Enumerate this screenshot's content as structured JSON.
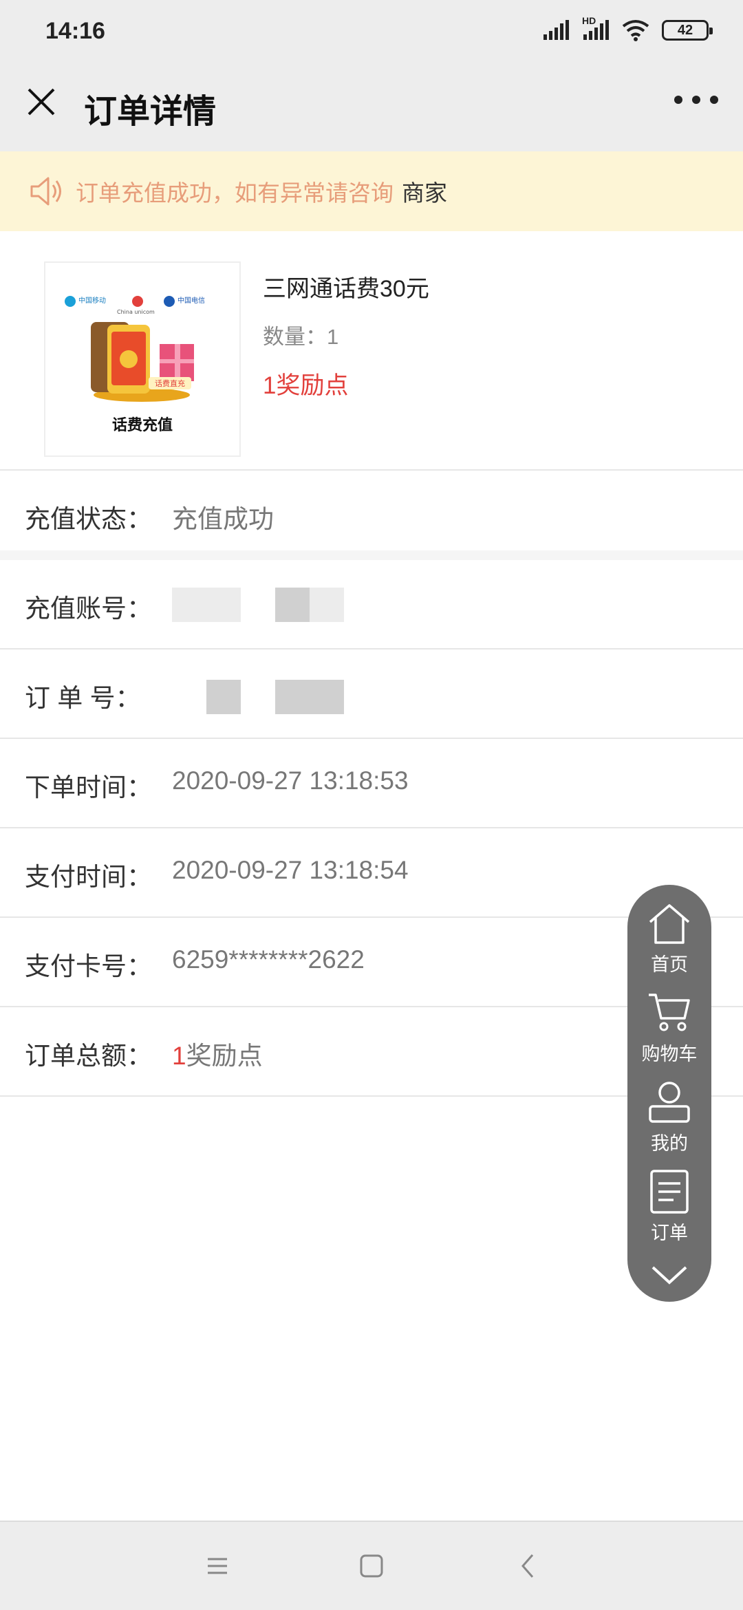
{
  "status": {
    "time": "14:16",
    "battery": "42",
    "signal_hd": "HD"
  },
  "header": {
    "title": "订单详情"
  },
  "notice": {
    "text": "订单充值成功，如有异常请咨询",
    "link": "商家"
  },
  "product": {
    "name": "三网通话费30元",
    "qty_label": "数量：",
    "qty": "1",
    "price": "1奖励点",
    "thumb_caption": "话费充值",
    "thumb_badge": "话费直充",
    "thumb_brands": [
      "中国移动",
      "China unicom",
      "中国电信"
    ]
  },
  "details": [
    {
      "label": "充值状态：",
      "value": "充值成功"
    },
    {
      "label": "充值账号：",
      "value": ""
    },
    {
      "label": "订 单 号：",
      "value": ""
    },
    {
      "label": "下单时间：",
      "value": "2020-09-27 13:18:53"
    },
    {
      "label": "支付时间：",
      "value": "2020-09-27 13:18:54"
    },
    {
      "label": "支付卡号：",
      "value": "6259********2622"
    },
    {
      "label": "订单总额：",
      "value_num": "1",
      "value_unit": "奖励点"
    }
  ],
  "float_menu": {
    "home": "首页",
    "cart": "购物车",
    "mine": "我的",
    "orders": "订单"
  },
  "colors": {
    "accent_red": "#e2403c",
    "notice_bg": "#fdf5d6",
    "notice_text": "#e79d7a",
    "float_bg": "#6e6e6e"
  }
}
